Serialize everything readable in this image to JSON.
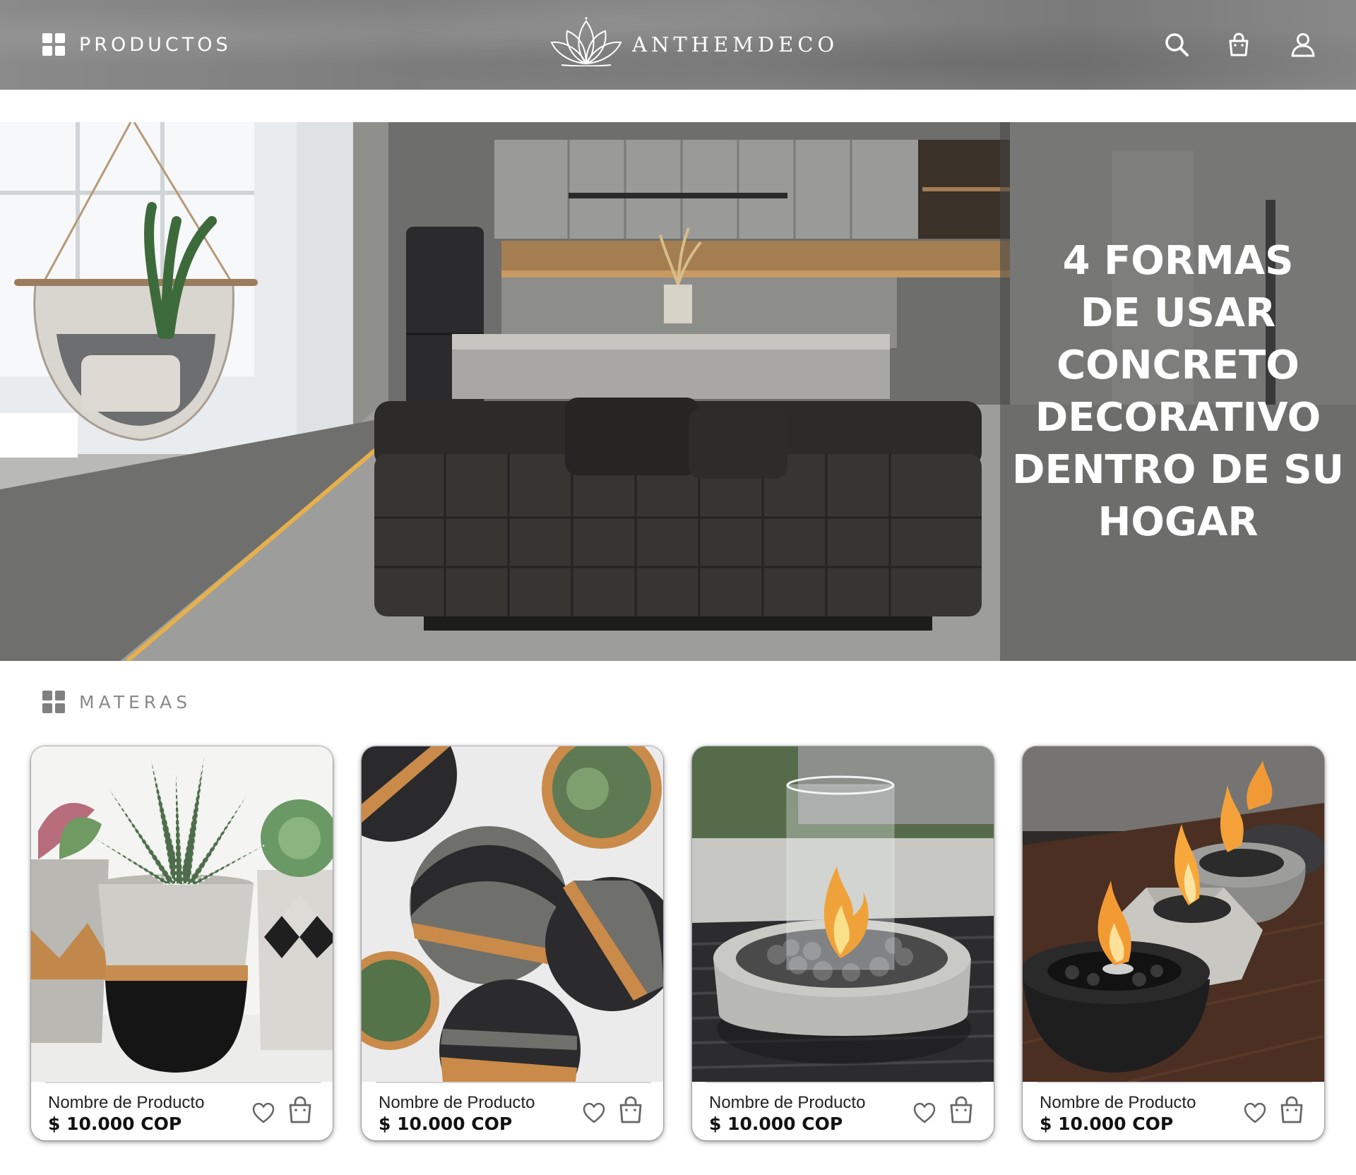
{
  "header": {
    "products_label": "PRODUCTOS",
    "logo_text": "ANTHEMDECO",
    "icons": [
      "grid-icon",
      "lotus-logo-icon",
      "search-icon",
      "shopping-bag-icon",
      "user-icon"
    ]
  },
  "hero": {
    "title_lines": [
      "4 FORMAS",
      "DE USAR",
      "CONCRETO",
      "DECORATIVO",
      "DENTRO DE SU",
      "HOGAR"
    ]
  },
  "section": {
    "title": "MATERAS"
  },
  "products": [
    {
      "name": "Nombre de Producto",
      "price": "$ 10.000 COP"
    },
    {
      "name": "Nombre de Producto",
      "price": "$ 10.000 COP"
    },
    {
      "name": "Nombre de Producto",
      "price": "$ 10.000 COP"
    },
    {
      "name": "Nombre de Producto",
      "price": "$ 10.000 COP"
    }
  ],
  "colors": {
    "header_bg": "#808080",
    "overlay": "#464646",
    "text_dark": "#111111",
    "section_title": "#8a8a8a"
  }
}
